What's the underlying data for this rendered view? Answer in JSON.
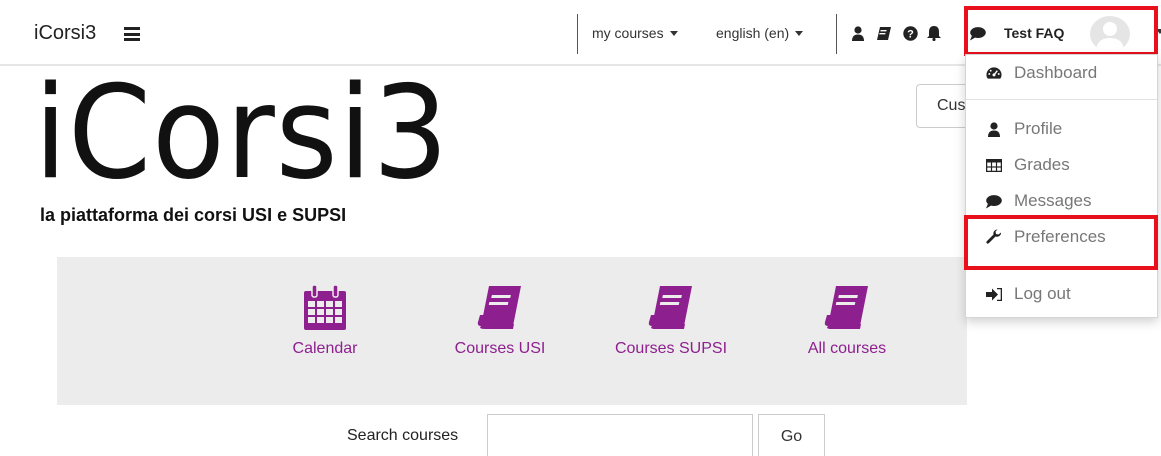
{
  "navbar": {
    "brand": "iCorsi3",
    "my_courses": "my courses",
    "language": "english (en)",
    "user_name": "Test FAQ"
  },
  "icons": [
    "menu-icon",
    "user-icon",
    "book-icon",
    "help-icon",
    "bell-icon",
    "chat-icon"
  ],
  "logo": {
    "text": "iCorsi3",
    "tagline": "la piattaforma dei corsi USI e SUPSI"
  },
  "customise_button": "Cus",
  "tiles": [
    {
      "label": "Calendar",
      "icon": "calendar-icon"
    },
    {
      "label": "Courses USI",
      "icon": "book-icon"
    },
    {
      "label": "Courses SUPSI",
      "icon": "book-icon"
    },
    {
      "label": "All courses",
      "icon": "book-icon"
    }
  ],
  "search": {
    "label": "Search courses",
    "value": "",
    "button": "Go"
  },
  "user_menu": {
    "items": [
      {
        "label": "Dashboard",
        "icon": "dashboard-icon"
      },
      {
        "label": "Profile",
        "icon": "user-icon"
      },
      {
        "label": "Grades",
        "icon": "table-icon"
      },
      {
        "label": "Messages",
        "icon": "chat-icon"
      },
      {
        "label": "Preferences",
        "icon": "wrench-icon"
      },
      {
        "label": "Log out",
        "icon": "logout-icon"
      }
    ]
  },
  "colors": {
    "accent": "#8e1f8f",
    "highlight": "#e8101a",
    "panel": "#ececec"
  }
}
